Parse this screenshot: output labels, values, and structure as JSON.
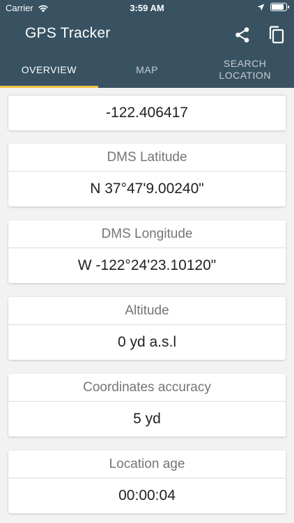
{
  "status_bar": {
    "carrier": "Carrier",
    "time": "3:59 AM",
    "battery_level": 0.9
  },
  "app_bar": {
    "title": "GPS Tracker",
    "icons": [
      "share-icon",
      "copy-icon"
    ]
  },
  "tabs": [
    {
      "label": "OVERVIEW",
      "active": true
    },
    {
      "label": "MAP",
      "active": false
    },
    {
      "label": "SEARCH\nLOCATION",
      "active": false
    }
  ],
  "colors": {
    "app_bar": "#385262",
    "tab_indicator": "#f5c244",
    "background": "#f2f2f2"
  },
  "cards": {
    "longitude_value": "-122.406417",
    "dms_latitude": {
      "label": "DMS Latitude",
      "value": "N 37°47'9.00240\""
    },
    "dms_longitude": {
      "label": "DMS Longitude",
      "value": "W -122°24'23.10120\""
    },
    "altitude": {
      "label": "Altitude",
      "value": "0 yd a.s.l"
    },
    "accuracy": {
      "label": "Coordinates accuracy",
      "value": "5 yd"
    },
    "location_age": {
      "label": "Location age",
      "value": "00:00:04"
    }
  }
}
